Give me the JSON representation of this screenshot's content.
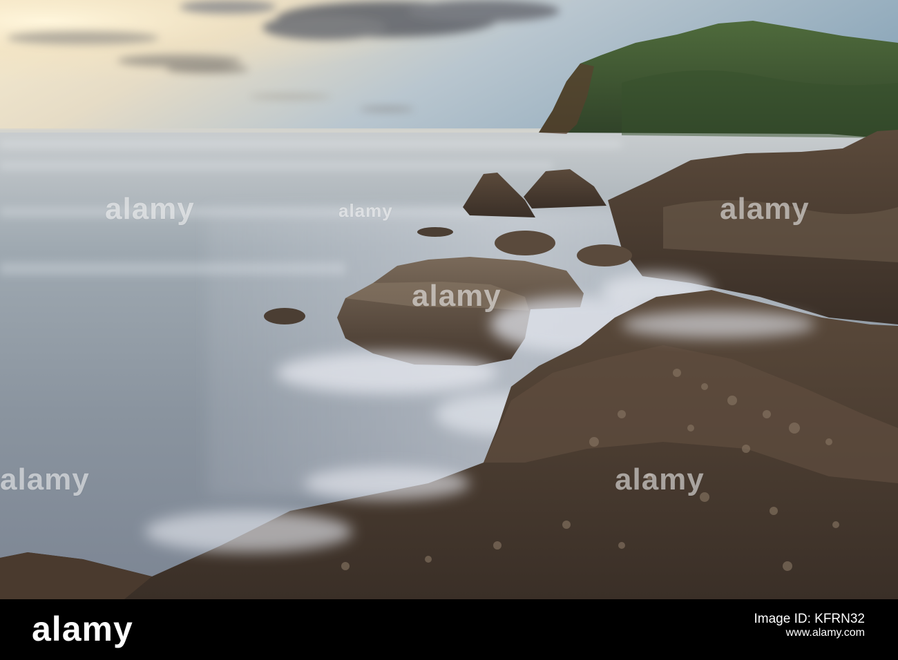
{
  "watermark": {
    "text": "alamy"
  },
  "footer": {
    "logo_text": "alamy",
    "image_id_label": "Image ID: KFRN32",
    "url": "www.alamy.com"
  },
  "colors": {
    "footer_background": "#000000",
    "sky_glow": "#f3e6c6",
    "sea": "#8e9aa6",
    "rock": "#4e4034",
    "headland": "#3f5a33"
  }
}
